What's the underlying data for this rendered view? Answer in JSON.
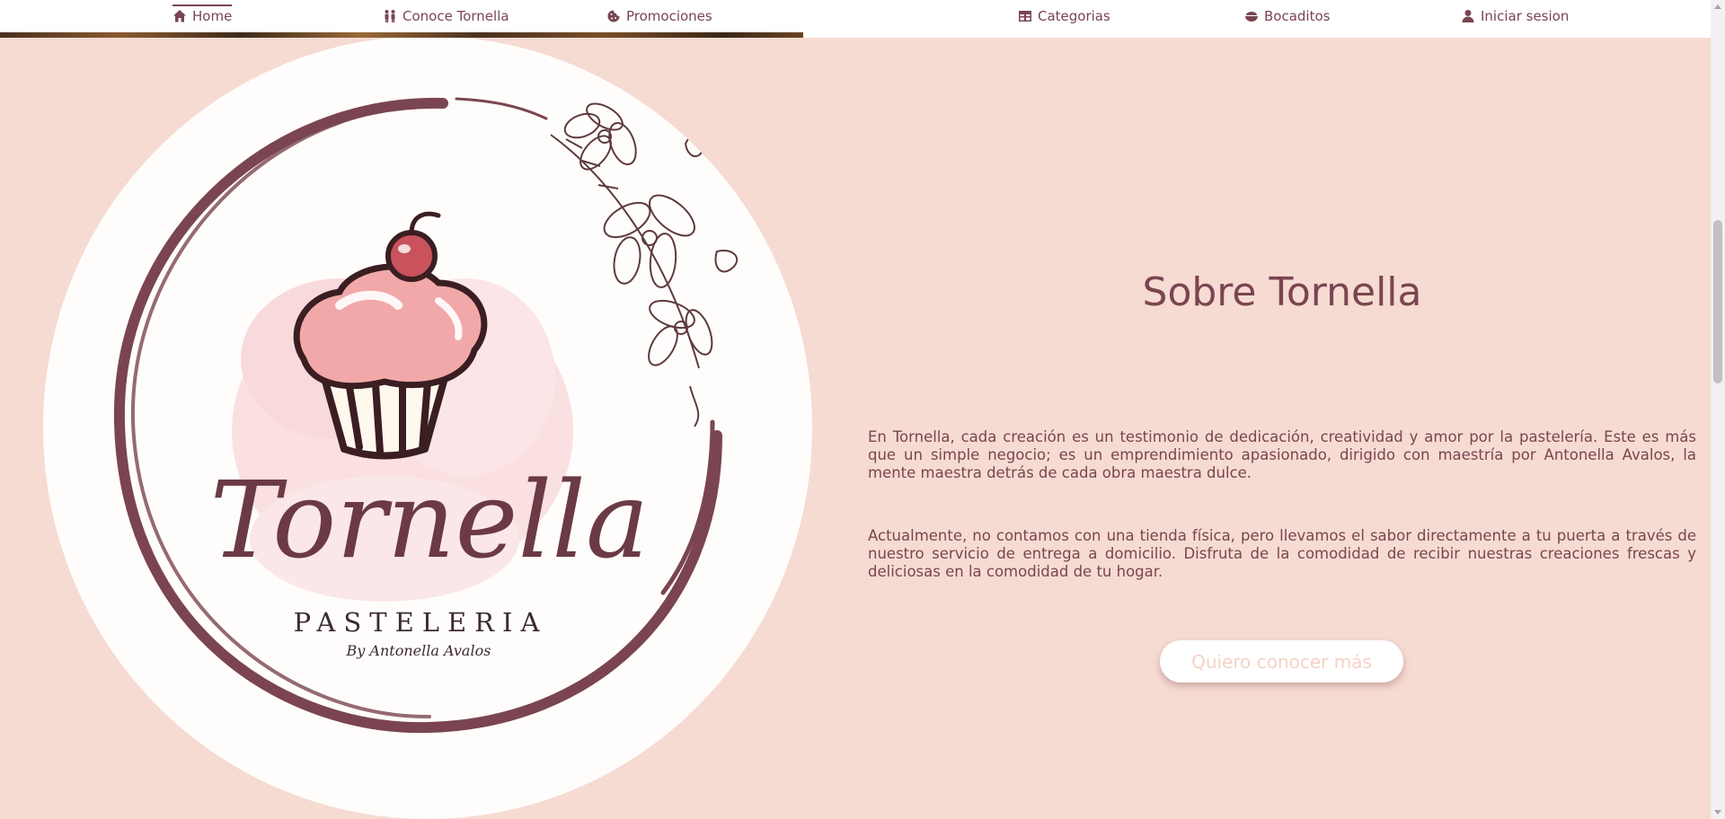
{
  "nav": {
    "items": [
      {
        "label": "Home",
        "icon": "home-icon",
        "active": true
      },
      {
        "label": "Conoce Tornella",
        "icon": "people-icon",
        "active": false
      },
      {
        "label": "Promociones",
        "icon": "cookie-icon",
        "active": false
      },
      {
        "label": "Categorias",
        "icon": "table-icon",
        "active": false
      },
      {
        "label": "Bocaditos",
        "icon": "bowl-icon",
        "active": false
      },
      {
        "label": "Iniciar sesion",
        "icon": "user-icon",
        "active": false
      }
    ]
  },
  "logo": {
    "name": "Tornella",
    "subtitle": "PASTELERIA",
    "byline": "By Antonella Avalos"
  },
  "about": {
    "title": "Sobre Tornella",
    "paragraph1": "En Tornella, cada creación es un testimonio de dedicación, creatividad y amor por la pastelería. Este es más que un simple negocio; es un emprendimiento apasionado, dirigido con maestría por Antonella Avalos, la mente maestra detrás de cada obra maestra dulce.",
    "paragraph2": "Actualmente, no contamos con una tienda física, pero llevamos el sabor directamente a tu puerta a través de nuestro servicio de entrega a domicilio. Disfruta de la comodidad de recibir nuestras creaciones frescas y deliciosas en la comodidad de tu hogar.",
    "cta_label": "Quiero conocer más"
  },
  "colors": {
    "background": "#f6dbd2",
    "accent": "#7a4550",
    "cupcake_frosting": "#f2a8a8",
    "cherry": "#c9525c"
  }
}
